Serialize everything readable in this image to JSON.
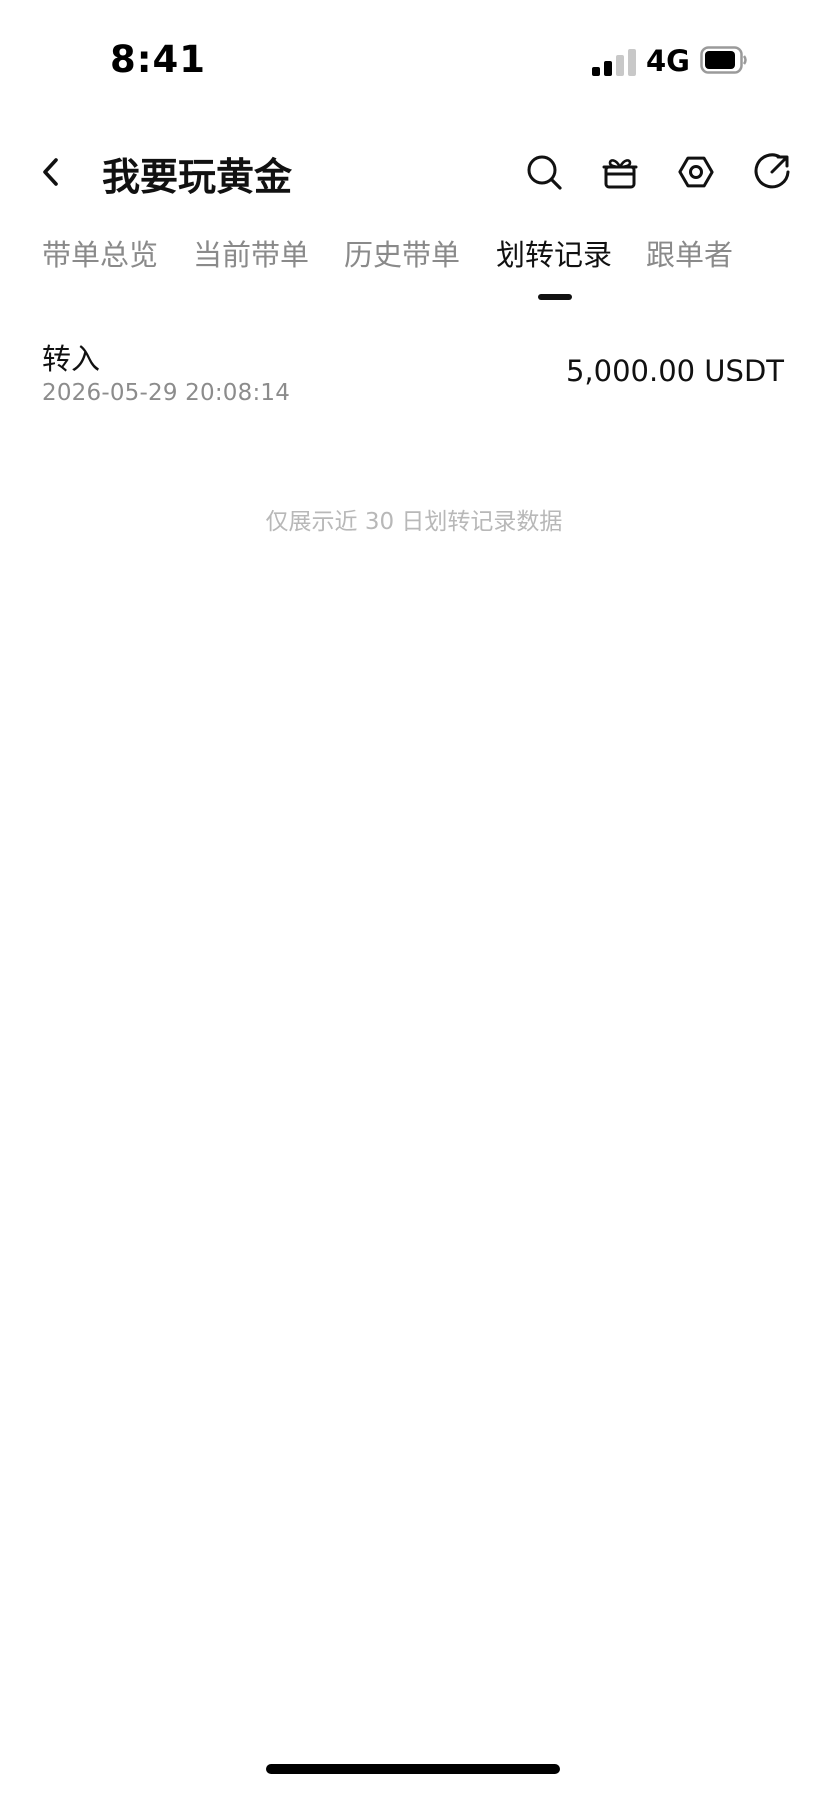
{
  "status_bar": {
    "time": "8:41",
    "network": "4G",
    "signal_icon": "signal-bars-icon",
    "battery_icon": "battery-icon"
  },
  "header": {
    "title": "我要玩黄金",
    "back_icon": "chevron-left-icon",
    "icons": [
      "search-icon",
      "gift-icon",
      "settings-hexagon-icon",
      "share-refresh-icon"
    ]
  },
  "tabs": [
    {
      "label": "带单总览",
      "active": false
    },
    {
      "label": "当前带单",
      "active": false
    },
    {
      "label": "历史带单",
      "active": false
    },
    {
      "label": "划转记录",
      "active": true
    },
    {
      "label": "跟单者",
      "active": false
    }
  ],
  "records": [
    {
      "type": "转入",
      "timestamp": "2026-05-29 20:08:14",
      "amount": "5,000.00 USDT"
    }
  ],
  "footer_note": "仅展示近 30 日划转记录数据",
  "colors": {
    "text_primary": "#111111",
    "text_secondary": "#8a8a8a",
    "text_hint": "#b8b8b8",
    "background": "#ffffff"
  }
}
